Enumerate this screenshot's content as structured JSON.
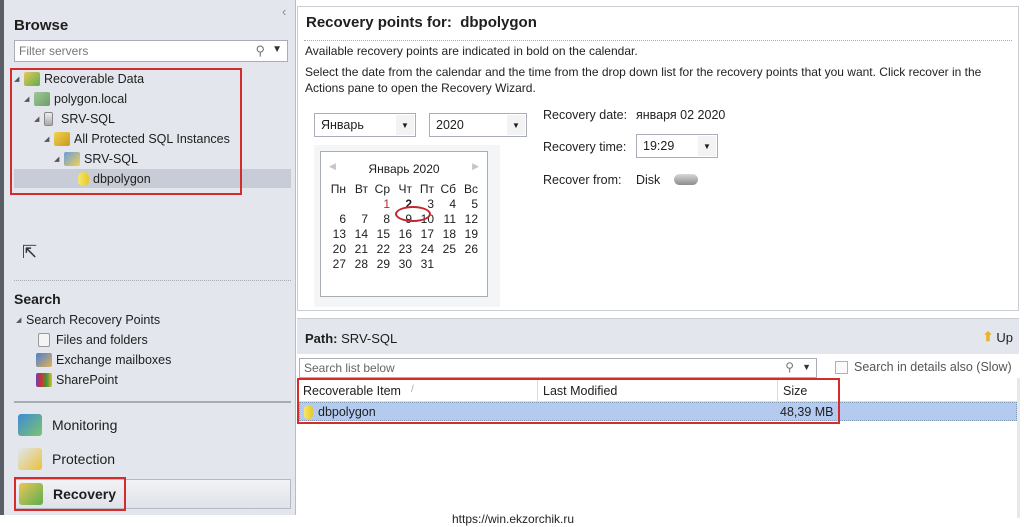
{
  "left": {
    "browse_title": "Browse",
    "filter_placeholder": "Filter servers",
    "tree": [
      {
        "label": "Recoverable Data",
        "icon": "recoverable-data-icon"
      },
      {
        "label": "polygon.local",
        "icon": "domain-icon"
      },
      {
        "label": "SRV-SQL",
        "icon": "server-icon"
      },
      {
        "label": "All Protected SQL Instances",
        "icon": "sql-instances-icon"
      },
      {
        "label": "SRV-SQL",
        "icon": "sql-server-icon"
      },
      {
        "label": "dbpolygon",
        "icon": "database-icon"
      }
    ],
    "search_title": "Search",
    "search_root": "Search Recovery Points",
    "search_items": [
      {
        "label": "Files and folders",
        "icon": "file-icon"
      },
      {
        "label": "Exchange mailboxes",
        "icon": "exchange-icon"
      },
      {
        "label": "SharePoint",
        "icon": "sharepoint-icon"
      }
    ],
    "nav": [
      {
        "label": "Monitoring",
        "icon": "monitoring-icon",
        "active": false
      },
      {
        "label": "Protection",
        "icon": "protection-icon",
        "active": false
      },
      {
        "label": "Recovery",
        "icon": "recovery-icon",
        "active": true
      }
    ]
  },
  "main": {
    "title_prefix": "Recovery points for:",
    "title_target": "dbpolygon",
    "info1": "Available recovery points are indicated in bold on the calendar.",
    "info2": "Select the date from the calendar and the time from the drop down list for the recovery points that you want. Click recover in the Actions pane to open the Recovery Wizard.",
    "month_select": "Январь",
    "year_select": "2020",
    "calendar": {
      "header": "Январь 2020",
      "weekdays": [
        "Пн",
        "Вт",
        "Ср",
        "Чт",
        "Пт",
        "Сб",
        "Вс"
      ],
      "leading_blanks": 2,
      "days": 31,
      "bold_days": [
        2
      ],
      "selected_day": 2
    },
    "recovery_date_label": "Recovery date:",
    "recovery_date_value": "января 02 2020",
    "recovery_time_label": "Recovery time:",
    "recovery_time_value": "19:29",
    "recover_from_label": "Recover from:",
    "recover_from_value": "Disk"
  },
  "bottom": {
    "path_label": "Path:",
    "path_value": "SRV-SQL",
    "up_label": "Up",
    "search_placeholder": "Search list below",
    "search_details_label": "Search in details also (Slow)",
    "columns": [
      "Recoverable Item",
      "Last Modified",
      "Size"
    ],
    "rows": [
      {
        "name": "dbpolygon",
        "modified": "",
        "size": "48,39 MB"
      }
    ]
  },
  "watermark": "https://win.ekzorchik.ru"
}
